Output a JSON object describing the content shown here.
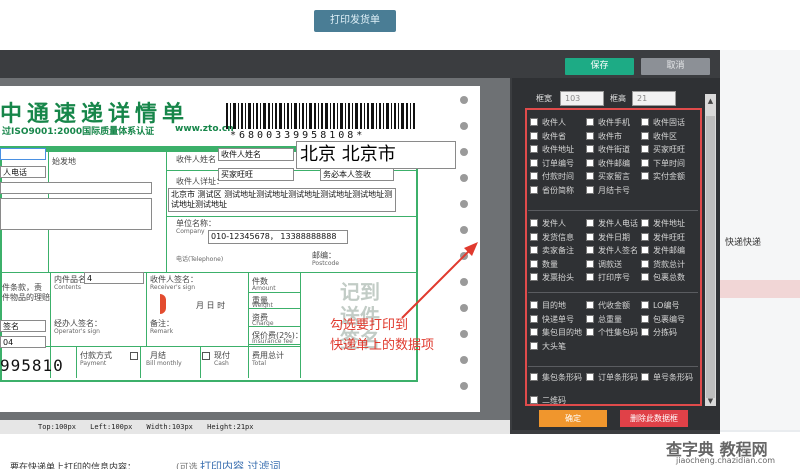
{
  "background": {
    "print_button": "打印发货单",
    "right_label": "快递快递",
    "bottom_text1": "要在快递单上打印的信息内容：",
    "bottom_text2": "(可选",
    "bottom_link": "打印内容 过滤词"
  },
  "dialog": {
    "save_label": "保存",
    "cancel_label": "取消"
  },
  "waybill": {
    "title": "中通速递详情单",
    "iso_text": "过ISO9001:2000国际质量体系认证",
    "url_text": "www.zto.cn",
    "barcode_number": "*6800339958108*",
    "sender_label": "始发地",
    "sender_phone_field": "人电话",
    "recipient_name_caption": "收件人姓名",
    "recipient_name_field": "收件人姓名",
    "destination_big": "北京 北京市",
    "buyer_nick_field": "买家旺旺",
    "sign_field": "务必本人签收",
    "recipient_address_caption": "收件人详址：",
    "recipient_address_field": "北京市 测试区 测试地址测试地址测试地址测试地址测试地址测试地址测试地址",
    "company_caption": "单位名称：",
    "company_caption_en": "Company",
    "phone_field": "010-12345678， 13388888888",
    "telephone_caption": "电话(Telephone)",
    "postcode_caption": "邮编：",
    "postcode_caption_en": "Postcode",
    "contents_caption": "内件品名",
    "contents_caption_en": "Contents",
    "contents_field": "4",
    "receiver_sign_caption": "收件人签名：",
    "receiver_sign_caption_en": "Receiver's sign",
    "items_caption": "件数",
    "items_caption_en": "Amount",
    "weight_caption": "重量",
    "weight_caption_en": "Weight",
    "charge_caption": "资费",
    "charge_caption_en": "Charge",
    "insurance_caption": "保价费(2%)：",
    "insurance_caption_en": "Insurance fee",
    "total_caption": "费用总计",
    "total_caption_en": "Total",
    "operator_caption": "经办人签名：",
    "operator_caption_en": "Operator's sign",
    "remark_caption": "备注：",
    "remark_caption_en": "Remark",
    "date_text": "月    日    时",
    "left_note": "件条款，责",
    "left_note2": "件物品的理赔",
    "sign_short": "签名",
    "field_04": "04",
    "payment_caption": "付款方式",
    "payment_caption_en": "Payment",
    "monthly_caption": "月结",
    "monthly_caption_en": "Bill monthly",
    "cash_caption": "现付",
    "cash_caption_en": "Cash",
    "waybill_number": "995810",
    "stamp_text": "记到\n送件\n签名",
    "annotation": "勾选要打印到\n快递单上的数据项"
  },
  "statusbar": {
    "top": "Top:100px",
    "left": "Left:100px",
    "width": "Width:103px",
    "height": "Height:21px"
  },
  "panel": {
    "width_label": "框宽",
    "width_value": "103",
    "height_label": "框高",
    "height_value": "21",
    "group1": [
      [
        "收件人",
        "收件手机",
        "收件固话"
      ],
      [
        "收件省",
        "收件市",
        "收件区"
      ],
      [
        "收件地址",
        "收件街道",
        "买家旺旺"
      ],
      [
        "订单编号",
        "收件邮编",
        "下单时间"
      ],
      [
        "付款时间",
        "买家留言",
        "实付金额"
      ],
      [
        "省份简称",
        "月结卡号",
        ""
      ]
    ],
    "group2": [
      [
        "发件人",
        "发件人电话",
        "发件地址"
      ],
      [
        "发货信息",
        "发件日期",
        "发件旺旺"
      ],
      [
        "卖家备注",
        "发件人签名",
        "发件邮编"
      ],
      [
        "数量",
        "调款送",
        "货款总计"
      ],
      [
        "发票抬头",
        "打印序号",
        "包裹总数"
      ]
    ],
    "group3": [
      [
        "目的地",
        "代收金额",
        "LO编号"
      ],
      [
        "快递单号",
        "总重量",
        "包裹编号"
      ],
      [
        "集包目的地",
        "个性集包码",
        "分拣码"
      ],
      [
        "大头笔",
        "",
        ""
      ]
    ],
    "group4": [
      [
        "集包条形码",
        "订单条形码",
        "单号条形码"
      ]
    ],
    "group5": [
      [
        "二维码",
        "",
        ""
      ]
    ],
    "ok_label": "确定",
    "delete_label": "删除此数据框"
  },
  "watermark": {
    "text": "查字典 教程网",
    "url": "jiaocheng.chazidian.com"
  }
}
